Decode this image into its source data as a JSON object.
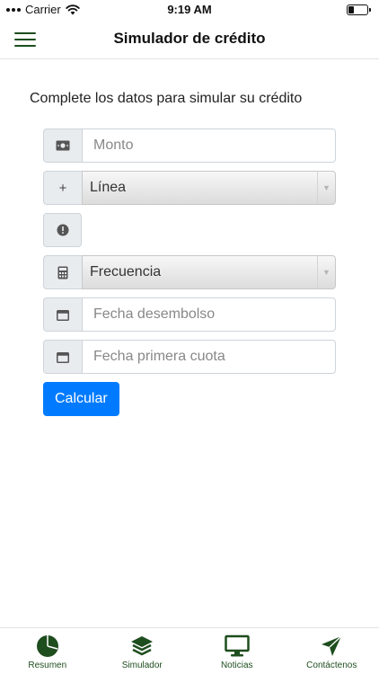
{
  "status_bar": {
    "carrier": "Carrier",
    "time": "9:19 AM",
    "battery_level": 0.3
  },
  "nav": {
    "title": "Simulador de crédito"
  },
  "main": {
    "intro": "Complete los datos para simular su crédito",
    "fields": {
      "monto_placeholder": "Monto",
      "linea_value": "Línea",
      "frecuencia_value": "Frecuencia",
      "fecha_desembolso_placeholder": "Fecha desembolso",
      "fecha_primera_cuota_placeholder": "Fecha primera cuota"
    },
    "submit_label": "Calcular"
  },
  "tabs": [
    {
      "label": "Resumen",
      "icon": "pie-chart-icon"
    },
    {
      "label": "Simulador",
      "icon": "layers-icon"
    },
    {
      "label": "Noticias",
      "icon": "monitor-icon"
    },
    {
      "label": "Contáctenos",
      "icon": "send-icon"
    }
  ],
  "colors": {
    "accent": "#1e4d1e",
    "button": "#007bff",
    "addon_bg": "#e9ecef"
  }
}
